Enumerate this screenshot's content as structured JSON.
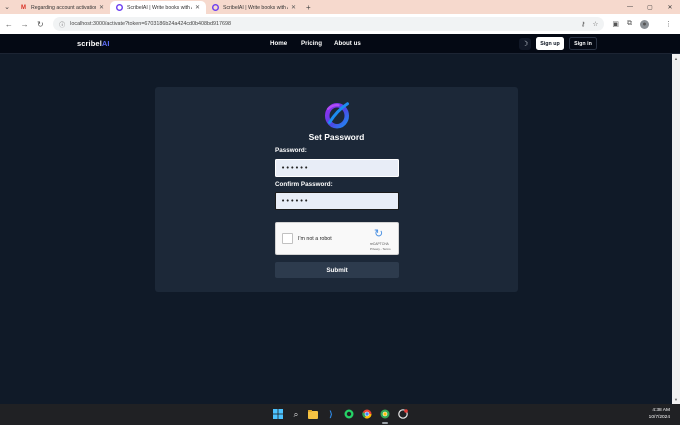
{
  "browser": {
    "tabs": [
      {
        "title": "Regarding account activation -",
        "icon": "gmail-icon",
        "active": false
      },
      {
        "title": "ScribelAI | Write books with AI",
        "icon": "scribel-icon",
        "active": true
      },
      {
        "title": "ScribelAI | Write books with AI",
        "icon": "scribel-icon",
        "active": false
      }
    ],
    "url": "localhost:3000/activate?token=6703186b24a424cd0b408bd917698"
  },
  "site": {
    "logo_main": "scribel",
    "logo_accent": "AI",
    "nav": [
      "Home",
      "Pricing",
      "About us"
    ],
    "signup_label": "Sign up",
    "signin_label": "Sign in"
  },
  "form": {
    "title": "Set Password",
    "password_label": "Password:",
    "password_value": "••••••",
    "confirm_label": "Confirm Password:",
    "confirm_value": "••••••",
    "recaptcha_text": "I'm not a robot",
    "recaptcha_brand": "reCAPTCHA",
    "recaptcha_links": "Privacy - Terms",
    "submit_label": "Submit"
  },
  "taskbar": {
    "time": "4:38 AM",
    "date": "10/7/2024"
  },
  "colors": {
    "page_bg": "#101a28",
    "card_bg": "#1c2838",
    "nav_bg": "#040914",
    "accent": "#5d6df5"
  }
}
